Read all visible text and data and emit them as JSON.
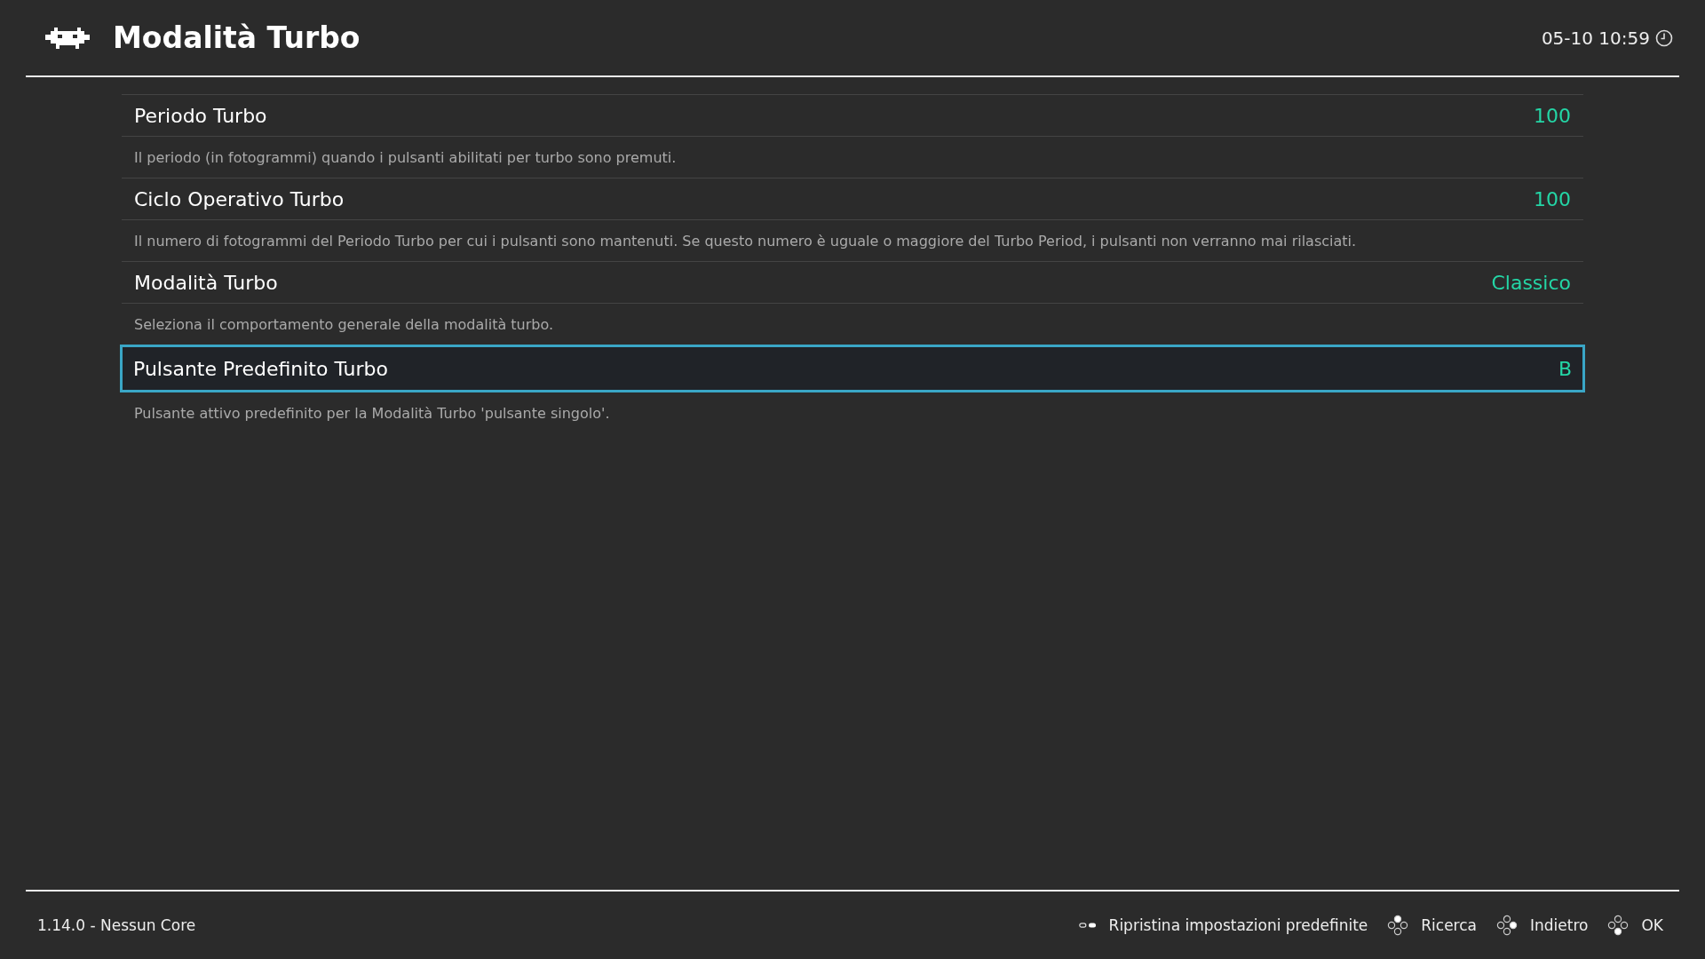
{
  "header": {
    "title": "Modalità Turbo",
    "clock": "05-10 10:59"
  },
  "settings": [
    {
      "label": "Periodo Turbo",
      "value": "100",
      "description": "Il periodo (in fotogrammi) quando i pulsanti abilitati per turbo sono premuti.",
      "selected": false
    },
    {
      "label": "Ciclo Operativo Turbo",
      "value": "100",
      "description": "Il numero di fotogrammi del Periodo Turbo per cui i pulsanti sono mantenuti. Se questo numero è uguale o maggiore del Turbo Period, i pulsanti non verranno mai rilasciati.",
      "selected": false
    },
    {
      "label": "Modalità Turbo",
      "value": "Classico",
      "description": "Seleziona il comportamento generale della modalità turbo.",
      "selected": false
    },
    {
      "label": "Pulsante Predefinito Turbo",
      "value": "B",
      "description": "Pulsante attivo predefinito per la Modalità Turbo 'pulsante singolo'.",
      "selected": true
    }
  ],
  "footer": {
    "version": "1.14.0 - Nessun Core",
    "actions": [
      {
        "kind": "select",
        "label": "Ripristina impostazioni predefinite"
      },
      {
        "kind": "top",
        "label": "Ricerca"
      },
      {
        "kind": "right",
        "label": "Indietro"
      },
      {
        "kind": "bottom",
        "label": "OK"
      }
    ]
  }
}
